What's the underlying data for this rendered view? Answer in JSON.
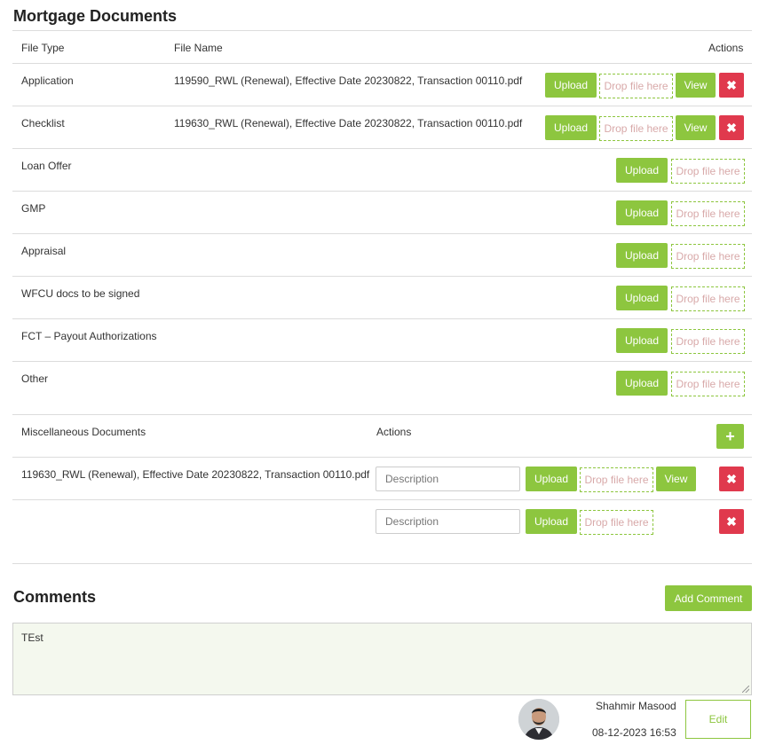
{
  "section_title": "Mortgage Documents",
  "headers": {
    "file_type": "File Type",
    "file_name": "File Name",
    "actions": "Actions"
  },
  "labels": {
    "upload": "Upload",
    "drop": "Drop file here",
    "view": "View",
    "delete": "✖",
    "add": "+"
  },
  "rows": [
    {
      "type": "Application",
      "file": "119590_RWL (Renewal), Effective Date 20230822, Transaction 00110.pdf"
    },
    {
      "type": "Checklist",
      "file": "119630_RWL (Renewal), Effective Date 20230822, Transaction 00110.pdf"
    },
    {
      "type": "Loan Offer",
      "file": ""
    },
    {
      "type": "GMP",
      "file": ""
    },
    {
      "type": "Appraisal",
      "file": ""
    },
    {
      "type": "WFCU docs to be signed",
      "file": ""
    },
    {
      "type": "FCT – Payout Authorizations",
      "file": ""
    },
    {
      "type": "Other",
      "file": ""
    }
  ],
  "misc": {
    "header": "Miscellaneous Documents",
    "actions": "Actions",
    "description_placeholder": "Description",
    "rows": [
      {
        "file": "119630_RWL (Renewal), Effective Date 20230822, Transaction 00110.pdf"
      },
      {
        "file": ""
      }
    ]
  },
  "comments": {
    "title": "Comments",
    "add_label": "Add Comment",
    "text": "TEst",
    "author": "Shahmir Masood",
    "timestamp": "08-12-2023 16:53",
    "edit_label": "Edit"
  }
}
